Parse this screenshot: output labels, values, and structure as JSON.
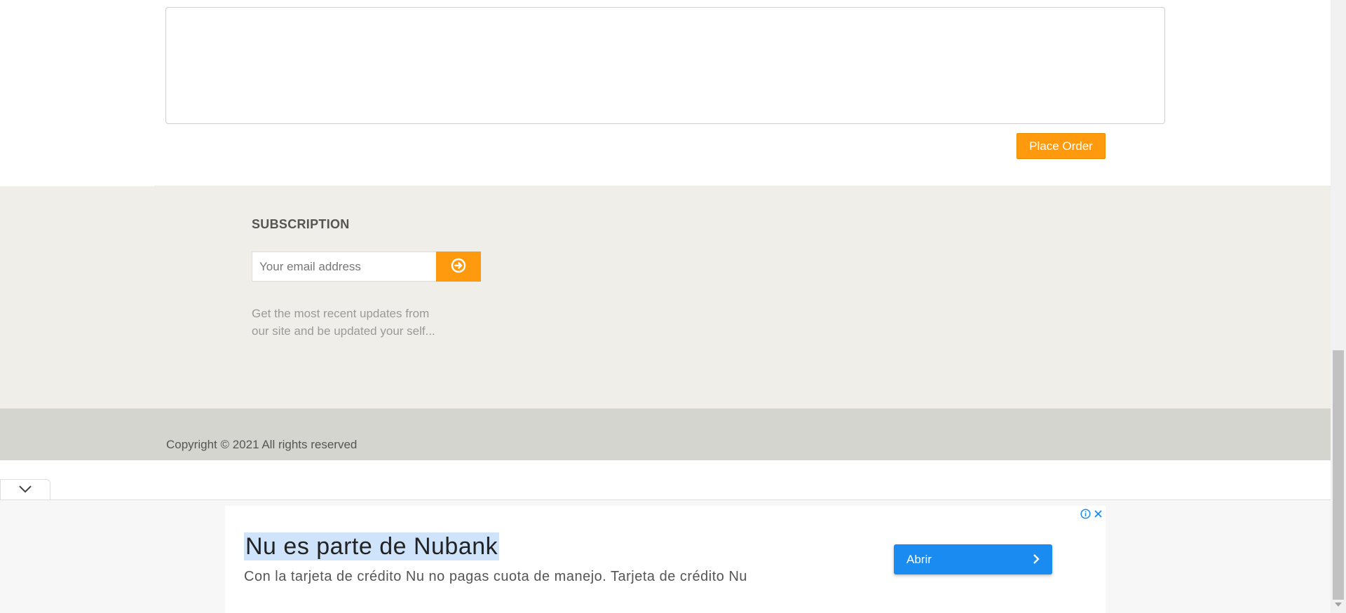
{
  "order": {
    "textarea_value": "",
    "place_order_label": "Place Order"
  },
  "subscription": {
    "title": "SUBSCRIPTION",
    "email_placeholder": "Your email address",
    "description_line1": "Get the most recent updates from",
    "description_line2": "our site and be updated your self..."
  },
  "footer": {
    "copyright": "Copyright © 2021 All rights reserved"
  },
  "ad": {
    "title": "Nu es parte de Nubank",
    "description": "Con la tarjeta de crédito Nu no pagas cuota de manejo. Tarjeta de crédito Nu",
    "open_label": "Abrir"
  },
  "colors": {
    "accent": "#ff9a0f",
    "subscription_bg": "#efeee8",
    "copyright_bg": "#d5d5cf",
    "ad_button": "#1a8bf0",
    "ad_title_highlight": "#cfe4fb"
  },
  "icons": {
    "subscribe": "arrow-circle-right-icon",
    "collapse": "chevron-down-icon",
    "ad_open": "chevron-right-icon",
    "ad_info": "info-icon",
    "ad_close": "close-icon"
  }
}
